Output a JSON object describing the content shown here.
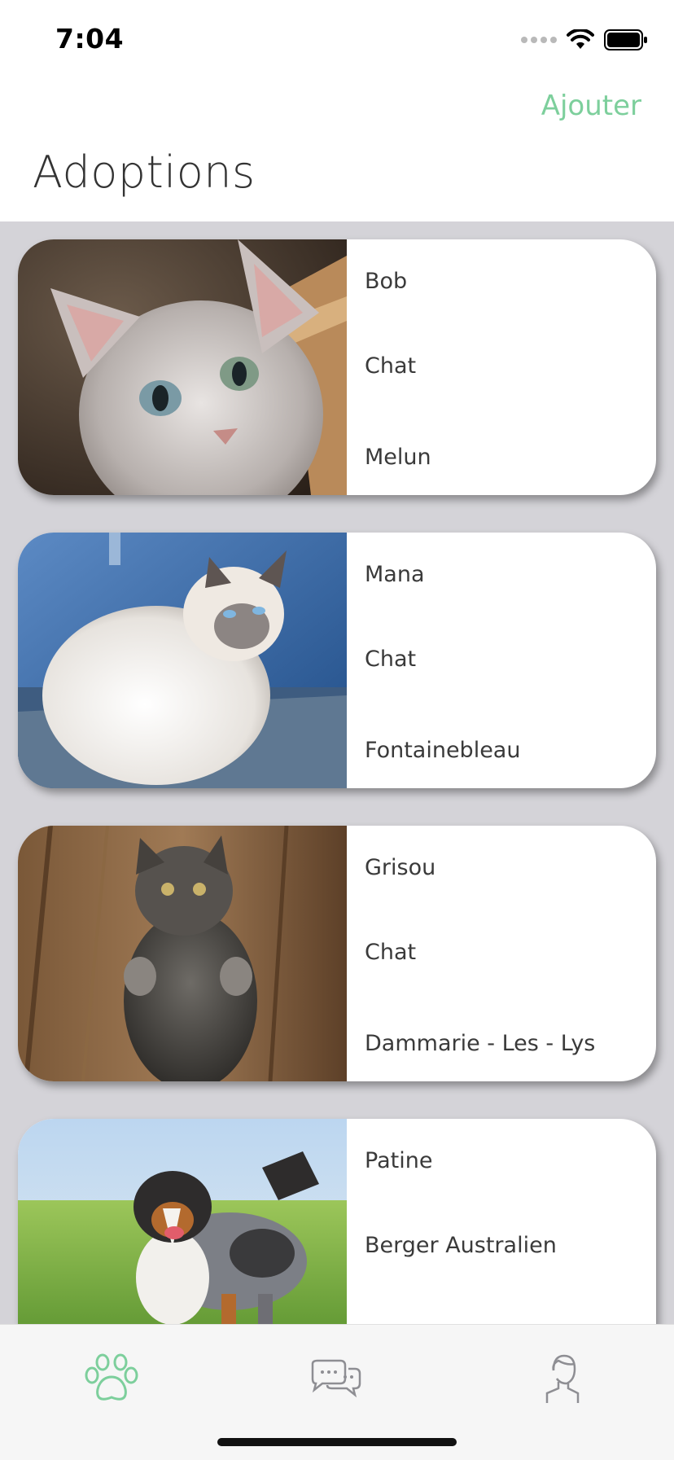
{
  "status_bar": {
    "time": "7:04",
    "icons": [
      "signal-icon",
      "wifi-icon",
      "battery-icon"
    ]
  },
  "nav": {
    "add_label": "Ajouter",
    "title": "Adoptions"
  },
  "colors": {
    "accent": "#7dcf9c",
    "list_background": "#d4d3d8",
    "tab_bar_background": "#f6f6f6",
    "inactive_icon": "#8e8e93"
  },
  "animals": [
    {
      "name": "Bob",
      "species": "Chat",
      "location": "Melun",
      "photo": "grey-kitten-photo"
    },
    {
      "name": "Mana",
      "species": "Chat",
      "location": "Fontainebleau",
      "photo": "white-cat-photo"
    },
    {
      "name": "Grisou",
      "species": "Chat",
      "location": "Dammarie - Les - Lys",
      "photo": "standing-grey-cat-photo"
    },
    {
      "name": "Patine",
      "species": "Berger Australien",
      "location": "",
      "photo": "australian-shepherd-photo"
    }
  ],
  "tab_bar": {
    "tabs": [
      {
        "icon": "paw-icon",
        "active": true
      },
      {
        "icon": "chat-bubbles-icon",
        "active": false
      },
      {
        "icon": "profile-icon",
        "active": false
      }
    ]
  }
}
